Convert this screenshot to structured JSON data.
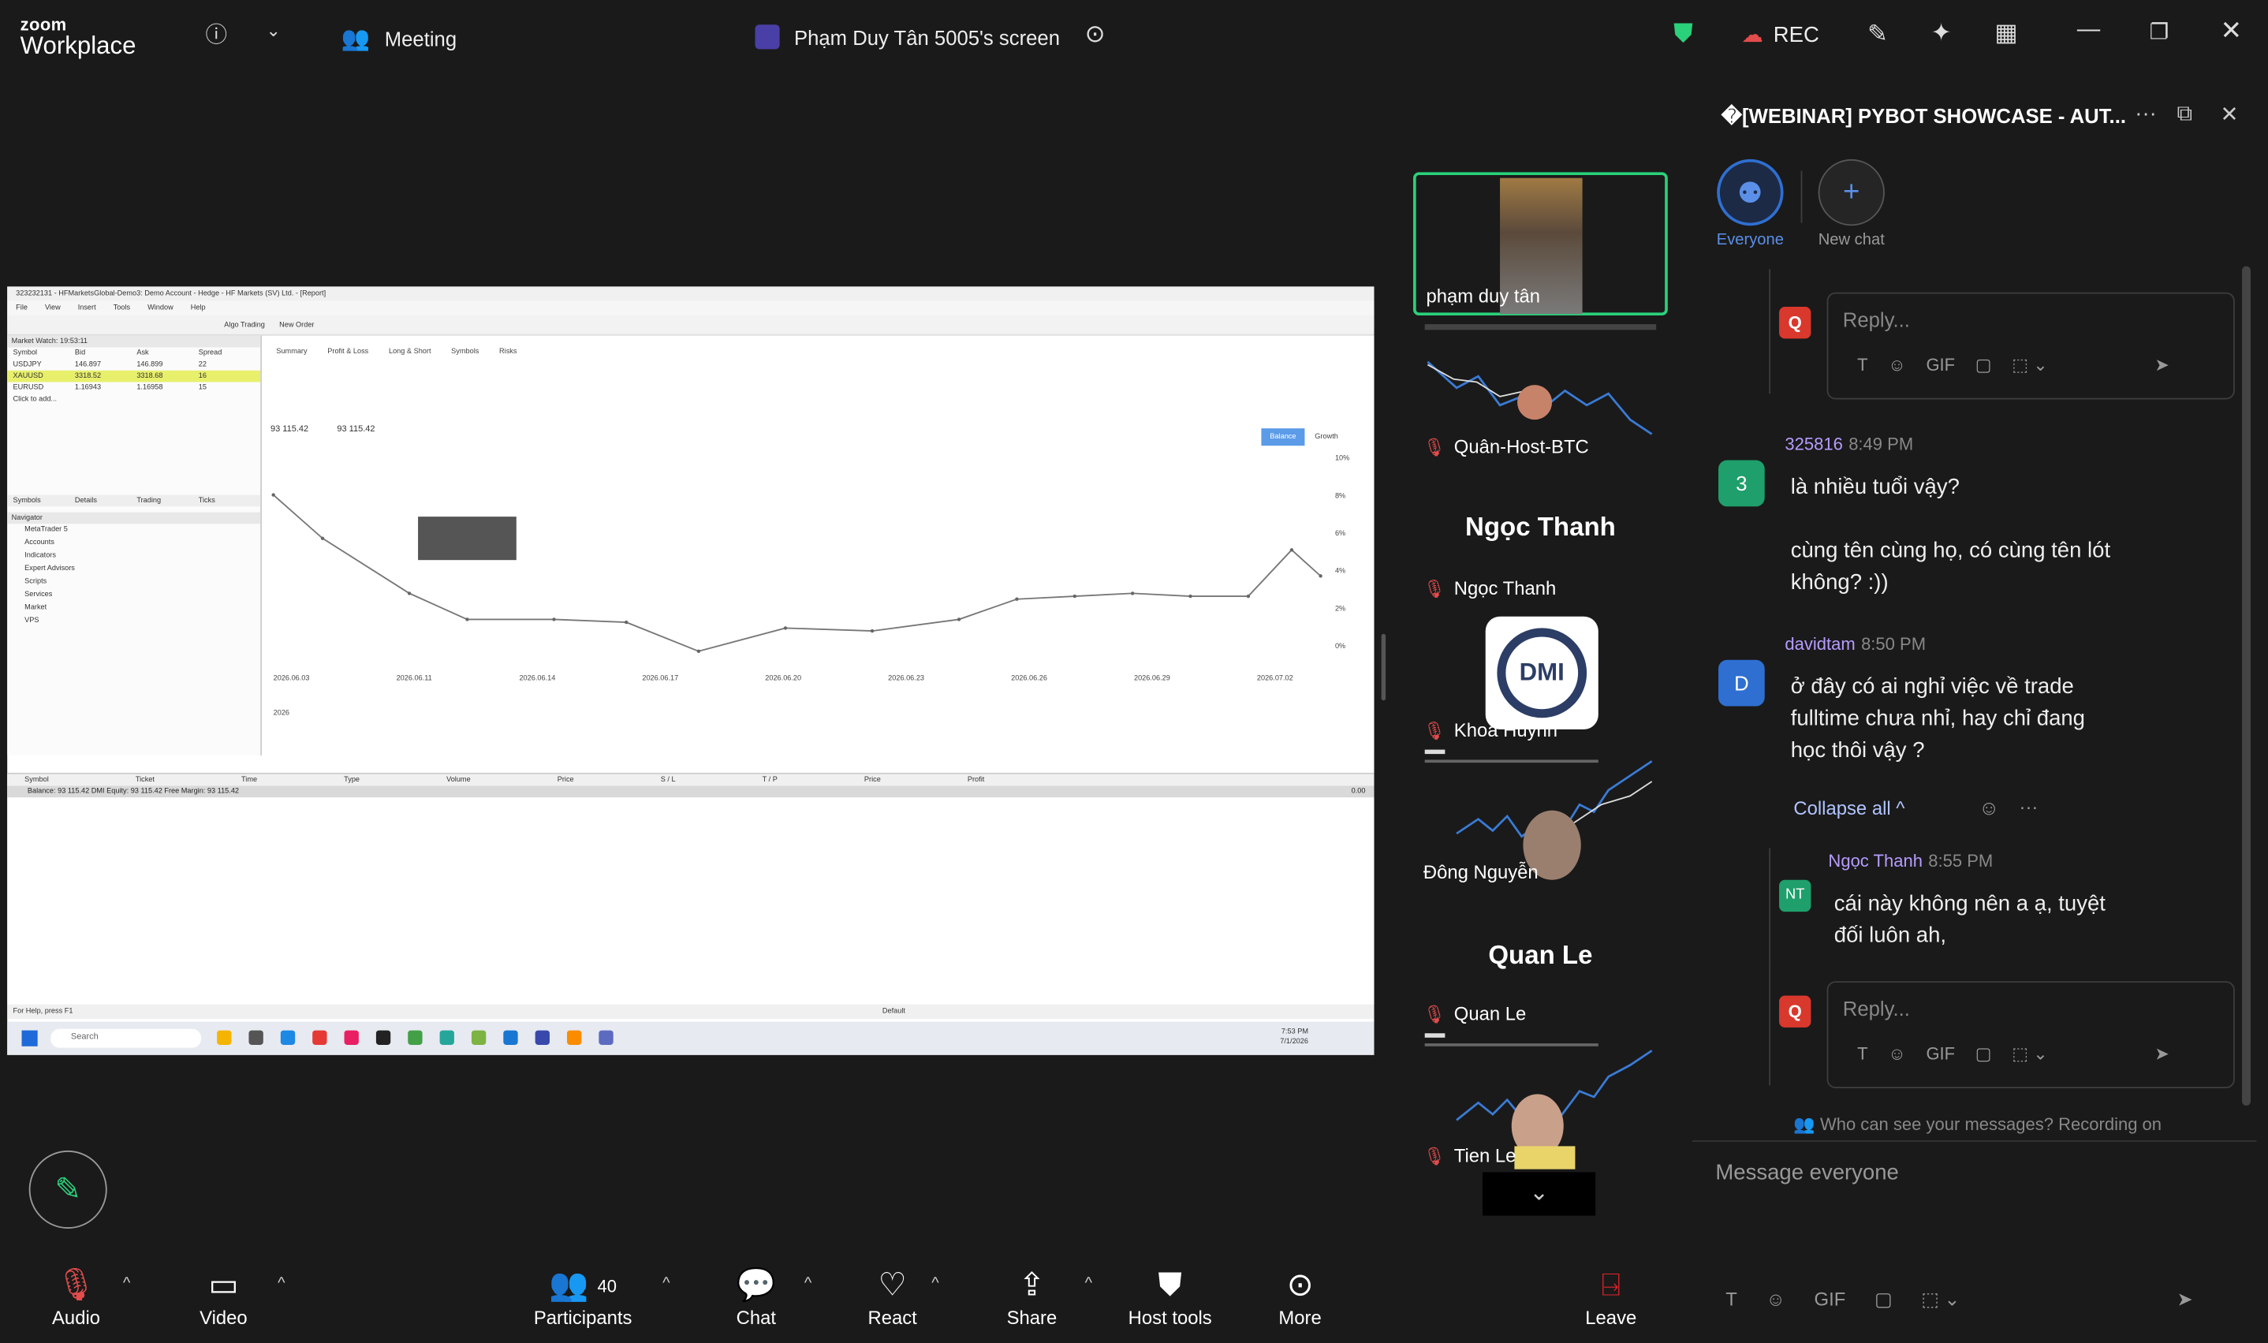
{
  "app": {
    "brand_line1": "zoom",
    "brand_line2": "Workplace",
    "meeting_label": "Meeting",
    "screen_label": "Phạm Duy Tân 5005's screen",
    "rec_label": "REC"
  },
  "shared_screen": {
    "title": "323232131 - HFMarketsGlobal-Demo3: Demo Account - Hedge - HF Markets (SV) Ltd. - [Report]",
    "menu": [
      "File",
      "View",
      "Insert",
      "Tools",
      "Window",
      "Help"
    ],
    "toolbar": [
      "Algo Trading",
      "New Order"
    ],
    "market_watch_header": "Market Watch: 19:53:11",
    "market_cols": [
      "Symbol",
      "Bid",
      "Ask",
      "Spread"
    ],
    "market_rows": [
      {
        "symbol": "USDJPY",
        "bid": "146.897",
        "ask": "146.899",
        "spread": "22",
        "selected": false
      },
      {
        "symbol": "XAUUSD",
        "bid": "3318.52",
        "ask": "3318.68",
        "spread": "16",
        "selected": true
      },
      {
        "symbol": "EURUSD",
        "bid": "1.16943",
        "ask": "1.16958",
        "spread": "15",
        "selected": false
      },
      {
        "symbol": "Click to add...",
        "bid": "",
        "ask": "",
        "spread": "",
        "selected": false
      }
    ],
    "market_tabs": [
      "Symbols",
      "Details",
      "Trading",
      "Ticks"
    ],
    "navigator_header": "Navigator",
    "navigator_items": [
      "MetaTrader 5",
      "Accounts",
      "Indicators",
      "Expert Advisors",
      "Scripts",
      "Services",
      "Market",
      "VPS"
    ],
    "report_tabs": [
      "Summary",
      "Profit & Loss",
      "Long & Short",
      "Symbols",
      "Risks"
    ],
    "balance_label": "93 115.42",
    "equity_label": "93 115.42",
    "legend_balance": "Balance",
    "legend_growth": "Growth",
    "x_ticks": [
      "2026.06.03",
      "2026.06.11",
      "2026.06.14",
      "2026.06.17",
      "2026.06.20",
      "2026.06.23",
      "2026.06.26",
      "2026.06.29",
      "2026.07.02"
    ],
    "y_ticks": [
      "10%",
      "8%",
      "6%",
      "4%",
      "2%",
      "0%"
    ],
    "year_label": "2026",
    "bottom_table_cols": [
      "Symbol",
      "Ticket",
      "Time",
      "Type",
      "Volume",
      "Price",
      "S / L",
      "T / P",
      "Price",
      "Profit"
    ],
    "balance_row": "Balance: 93 115.42 DMI Equity: 93 115.42 Free Margin: 93 115.42",
    "balance_row_value": "0.00",
    "status_left": "For Help, press F1",
    "status_mid": "Default",
    "taskbar_search": "Search",
    "taskbar_time": "7:53 PM",
    "taskbar_date": "7/1/2026"
  },
  "participants": [
    {
      "name": "phạm duy tân",
      "kind": "video",
      "active": true
    },
    {
      "name": "Quân-Host-BTC",
      "kind": "chart",
      "muted": true
    },
    {
      "name": "Ngọc Thanh",
      "kind": "name-only",
      "muted": true,
      "big_name": "Ngọc Thanh"
    },
    {
      "name": "Khoa Huỳnh",
      "kind": "logo",
      "muted": true,
      "logo_text": "DMI"
    },
    {
      "name": "Đông Nguyễn",
      "kind": "chart",
      "muted": false
    },
    {
      "name": "Quan Le",
      "kind": "name-only",
      "muted": true,
      "big_name": "Quan Le"
    },
    {
      "name": "Tien Le",
      "kind": "chart",
      "muted": true
    }
  ],
  "chat": {
    "title": "�[WEBINAR] PYBOT SHOWCASE - AUT...",
    "channels": [
      {
        "label": "Everyone",
        "active": true
      },
      {
        "label": "New chat",
        "active": false
      }
    ],
    "reply_placeholder": "Reply...",
    "messages": [
      {
        "sender": "325816",
        "time": "8:49 PM",
        "avatar": "3",
        "avatar_color": "#1f9f6b",
        "lines": [
          "là nhiều tuổi vậy?",
          "",
          "cùng tên cùng họ, có cùng tên lót",
          "không? :))"
        ]
      },
      {
        "sender": "davidtam",
        "time": "8:50 PM",
        "avatar": "D",
        "avatar_color": "#2f6fd1",
        "lines": [
          "ở đây có ai nghỉ việc về trade",
          "fulltime chưa nhỉ, hay chỉ đang",
          "học thôi vậy ?"
        ]
      }
    ],
    "collapse_label": "Collapse all ^",
    "reply": {
      "sender": "Ngọc Thanh",
      "time": "8:55 PM",
      "avatar": "NT",
      "avatar_color": "#1f9f6b",
      "lines": [
        "cái này không nên a ạ, tuyệt",
        "đối luôn ah,"
      ]
    },
    "who_can_see": "Who can see your messages? Recording on",
    "message_placeholder": "Message everyone",
    "tool_gif": "GIF"
  },
  "toolbar": {
    "audio": "Audio",
    "video": "Video",
    "participants": "Participants",
    "participants_count": "40",
    "chat": "Chat",
    "react": "React",
    "share": "Share",
    "host_tools": "Host tools",
    "more": "More",
    "leave": "Leave"
  },
  "colors": {
    "accent_green": "#2bd07a",
    "leave_red": "#e0242b",
    "chat_sender": "#b69cff",
    "channel_blue": "#2f6fd1"
  }
}
